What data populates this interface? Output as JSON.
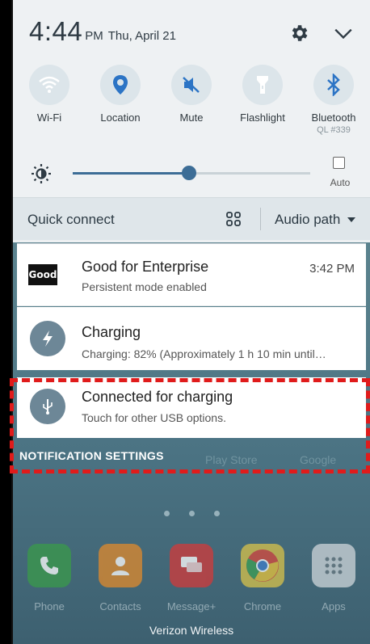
{
  "status": {
    "time": "4:44",
    "ampm": "PM",
    "date": "Thu, April 21"
  },
  "icons": {
    "settings": "gear-icon",
    "expand": "chevron-down-icon"
  },
  "quick_toggles": [
    {
      "label": "Wi-Fi",
      "icon": "wifi-icon",
      "sub": ""
    },
    {
      "label": "Location",
      "icon": "location-pin-icon",
      "sub": ""
    },
    {
      "label": "Mute",
      "icon": "mute-icon",
      "sub": ""
    },
    {
      "label": "Flashlight",
      "icon": "flashlight-icon",
      "sub": ""
    },
    {
      "label": "Bluetooth",
      "icon": "bluetooth-icon",
      "sub": "QL #339"
    }
  ],
  "brightness": {
    "level": 0.49,
    "auto_label": "Auto",
    "auto_checked": false
  },
  "quick_connect": {
    "label": "Quick connect",
    "audio_path_label": "Audio path"
  },
  "notifications": [
    {
      "app_logo_text": "Good",
      "title": "Good for Enterprise",
      "subtitle": "Persistent mode enabled",
      "time": "3:42 PM"
    },
    {
      "title": "Charging",
      "subtitle": "Charging: 82% (Approximately 1 h 10 min until…",
      "icon": "lightning-icon"
    },
    {
      "title": "Connected for charging",
      "subtitle": "Touch for other USB options.",
      "icon": "usb-icon"
    }
  ],
  "notification_settings_label": "NOTIFICATION SETTINGS",
  "home": {
    "ghost_labels": [
      "Play Store",
      "Google"
    ],
    "dock": [
      {
        "label": "Phone",
        "icon": "phone-icon",
        "color": "#3a9a4a"
      },
      {
        "label": "Contacts",
        "icon": "contacts-icon",
        "color": "#e08a2c"
      },
      {
        "label": "Message+",
        "icon": "message-icon",
        "color": "#d23a3a"
      },
      {
        "label": "Chrome",
        "icon": "chrome-icon",
        "color": "#d8c24a"
      },
      {
        "label": "Apps",
        "icon": "apps-grid-icon",
        "color": "#cfd6da"
      }
    ],
    "carrier": "Verizon Wireless"
  },
  "colors": {
    "accent": "#3c6d96",
    "highlight": "#e01b1b"
  }
}
